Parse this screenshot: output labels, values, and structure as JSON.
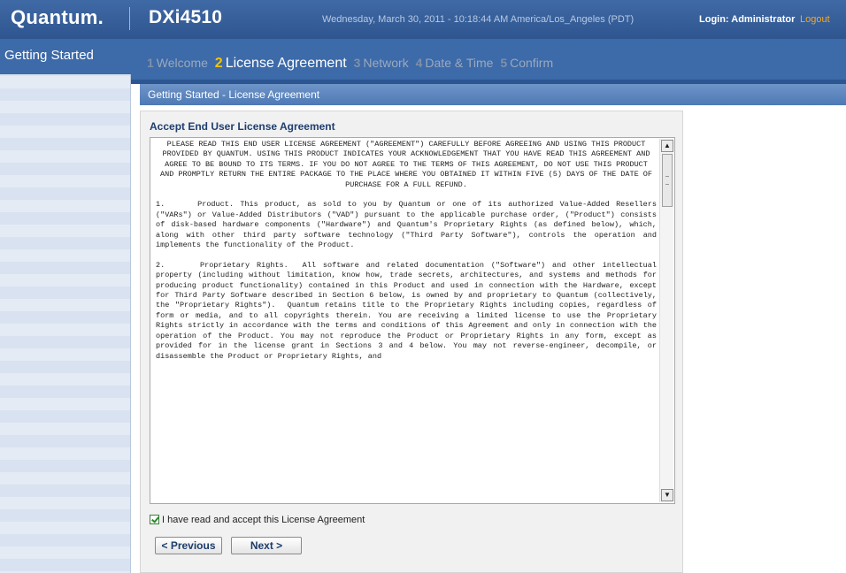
{
  "header": {
    "brand": "Quantum.",
    "product": "DXi4510",
    "datetime": "Wednesday, March 30, 2011 - 10:18:44 AM America/Los_Angeles (PDT)",
    "login": "Login: Administrator",
    "logout": "Logout"
  },
  "sidebar": {
    "items": [
      {
        "label": "Getting Started"
      }
    ]
  },
  "wizard": {
    "steps": [
      {
        "num": "1",
        "label": "Welcome"
      },
      {
        "num": "2",
        "label": "License Agreement"
      },
      {
        "num": "3",
        "label": "Network"
      },
      {
        "num": "4",
        "label": "Date & Time"
      },
      {
        "num": "5",
        "label": "Confirm"
      }
    ],
    "active_step": "License Agreement"
  },
  "section": {
    "title": "Getting Started - License Agreement"
  },
  "panel": {
    "title": "Accept End User License Agreement",
    "eula": [
      "PLEASE READ THIS END USER LICENSE AGREEMENT (\"AGREEMENT\") CAREFULLY BEFORE AGREEING AND USING THIS PRODUCT PROVIDED BY QUANTUM. USING THIS PRODUCT INDICATES YOUR ACKNOWLEDGEMENT THAT YOU HAVE READ THIS AGREEMENT AND AGREE TO BE BOUND TO ITS TERMS. IF YOU DO NOT AGREE TO THE TERMS OF THIS AGREEMENT, DO NOT USE THIS PRODUCT AND PROMPTLY RETURN THE ENTIRE PACKAGE TO THE PLACE WHERE YOU OBTAINED IT WITHIN FIVE (5) DAYS OF THE DATE OF PURCHASE FOR A FULL REFUND.",
      "1.     Product. This product, as sold to you by Quantum or one of its authorized Value-Added Resellers (\"VARs\") or Value-Added Distributors (\"VAD\") pursuant to the applicable purchase order, (\"Product\") consists of disk-based hardware components (\"Hardware\") and Quantum's Proprietary Rights (as defined below), which, along with other third party software technology (\"Third Party Software\"), controls the operation and implements the functionality of the Product.",
      "2.     Proprietary Rights.  All software and related documentation (\"Software\") and other intellectual property (including without limitation, know how, trade secrets, architectures, and systems and methods for producing product functionality) contained in this Product and used in connection with the Hardware, except for Third Party Software described in Section 6 below, is owned by and proprietary to Quantum (collectively, the \"Proprietary Rights\").  Quantum retains title to the Proprietary Rights including copies, regardless of form or media, and to all copyrights therein. You are receiving a limited license to use the Proprietary Rights strictly in accordance with the terms and conditions of this Agreement and only in connection with the operation of the Product. You may not reproduce the Product or Proprietary Rights in any form, except as provided for in the license grant in Sections 3 and 4 below. You may not reverse-engineer, decompile, or disassemble the Product or Proprietary Rights, and"
    ],
    "accept_label": "I have read and accept this License Agreement",
    "accept_checked": true,
    "previous_label": "< Previous",
    "next_label": "Next >"
  },
  "colors": {
    "header_blue": "#3d6aa8",
    "active_step_number": "#f5c400",
    "logout": "#f5a623",
    "panel_title": "#1f3e6e"
  },
  "icons": {
    "scroll_up": "scroll-up-arrow-icon",
    "scroll_down": "scroll-down-arrow-icon",
    "checkbox": "checkmark-icon"
  }
}
